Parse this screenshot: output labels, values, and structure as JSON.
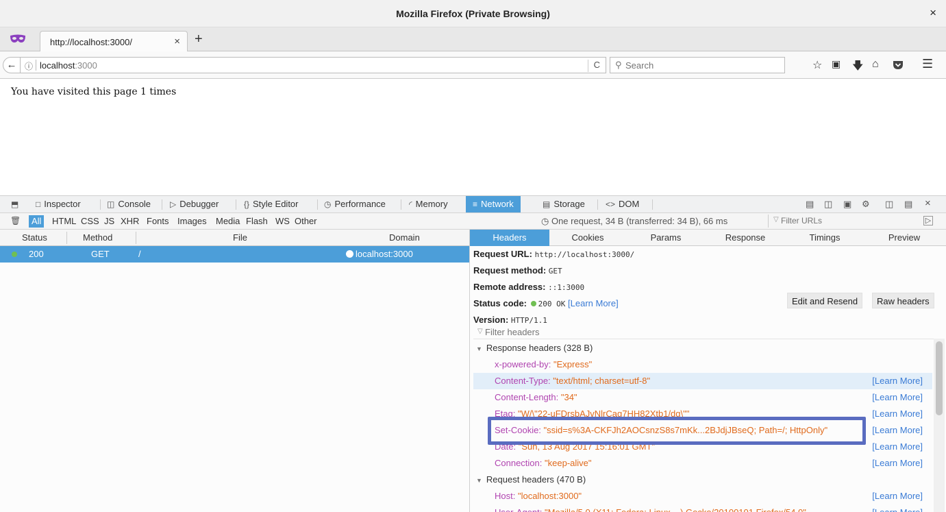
{
  "window": {
    "title": "Mozilla Firefox (Private Browsing)",
    "close_glyph": "×"
  },
  "tabstrip": {
    "tab_title": "http://localhost:3000/",
    "tab_close": "×",
    "new_tab": "+"
  },
  "navbar": {
    "back_glyph": "←",
    "info_glyph": "ⓘ",
    "url_host": "localhost",
    "url_port": ":3000",
    "reload_glyph": "C",
    "search_placeholder": "Search",
    "toolbar_icons": [
      "star-icon",
      "reading-list-icon",
      "download-icon",
      "home-icon",
      "pocket-icon",
      "menu-icon"
    ]
  },
  "page": {
    "message": "You have visited this page 1 times"
  },
  "devtools": {
    "tools": [
      {
        "label": "Inspector",
        "icon": "inspector-icon"
      },
      {
        "label": "Console",
        "icon": "console-icon"
      },
      {
        "label": "Debugger",
        "icon": "debugger-icon"
      },
      {
        "label": "Style Editor",
        "icon": "style-editor-icon"
      },
      {
        "label": "Performance",
        "icon": "performance-icon"
      },
      {
        "label": "Memory",
        "icon": "memory-icon"
      },
      {
        "label": "Network",
        "icon": "network-icon",
        "active": true
      },
      {
        "label": "Storage",
        "icon": "storage-icon"
      },
      {
        "label": "DOM",
        "icon": "dom-icon"
      }
    ],
    "filters": [
      "All",
      "HTML",
      "CSS",
      "JS",
      "XHR",
      "Fonts",
      "Images",
      "Media",
      "Flash",
      "WS",
      "Other"
    ],
    "active_filter": "All",
    "summary": "One request, 34 B (transferred: 34 B), 66 ms",
    "filter_urls_placeholder": "Filter URLs",
    "columns": [
      "Status",
      "Method",
      "File",
      "Domain"
    ],
    "request": {
      "status": "200",
      "method": "GET",
      "file": "/",
      "domain": "localhost:3000"
    },
    "detail_tabs": [
      "Headers",
      "Cookies",
      "Params",
      "Response",
      "Timings",
      "Preview"
    ],
    "active_detail_tab": "Headers",
    "summary_lines": {
      "request_url_label": "Request URL:",
      "request_url": "http://localhost:3000/",
      "request_method_label": "Request method:",
      "request_method": "GET",
      "remote_address_label": "Remote address:",
      "remote_address": "::1:3000",
      "status_code_label": "Status code:",
      "status_code": "200 OK",
      "learn_more_bracket": "[Learn More]",
      "version_label": "Version:",
      "version": "HTTP/1.1"
    },
    "buttons": {
      "edit_resend": "Edit and Resend",
      "raw_headers": "Raw headers"
    },
    "filter_headers_placeholder": "Filter headers",
    "response_headers_title": "Response headers (328 B)",
    "response_headers": [
      {
        "name": "x-powered-by:",
        "value": "\"Express\"",
        "learn_more": ""
      },
      {
        "name": "Content-Type:",
        "value": "\"text/html; charset=utf-8\"",
        "learn_more": "[Learn More]",
        "highlighted": true
      },
      {
        "name": "Content-Length:",
        "value": "\"34\"",
        "learn_more": "[Learn More]"
      },
      {
        "name": "Etag:",
        "value": "\"W/\\\"22-uFDrsbAJvNlrCag7HH82Xtb1/dg\\\"\"",
        "learn_more": "[Learn More]"
      },
      {
        "name": "Set-Cookie:",
        "value": "\"ssid=s%3A-CKFJh2AOCsnzS8s7mKk...2BJdjJBseQ; Path=/; HttpOnly\"",
        "learn_more": "[Learn More]"
      },
      {
        "name": "Date:",
        "value": "\"Sun, 13 Aug 2017 15:16:01 GMT\"",
        "learn_more": "[Learn More]"
      },
      {
        "name": "Connection:",
        "value": "\"keep-alive\"",
        "learn_more": "[Learn More]"
      }
    ],
    "request_headers_title": "Request headers (470 B)",
    "request_headers": [
      {
        "name": "Host:",
        "value": "\"localhost:3000\"",
        "learn_more": "[Learn More]"
      },
      {
        "name": "User-Agent:",
        "value": "\"Mozilla/5.0 (X11; Fedora; Linux ...) Gecko/20100101 Firefox/54.0\"",
        "learn_more": "[Learn More]"
      }
    ]
  },
  "colors": {
    "accent": "#4c9ed9",
    "highlight_box": "#5a6cc0",
    "header_name": "#b044b0",
    "header_value": "#e06a1c",
    "link": "#3a7bd5"
  }
}
